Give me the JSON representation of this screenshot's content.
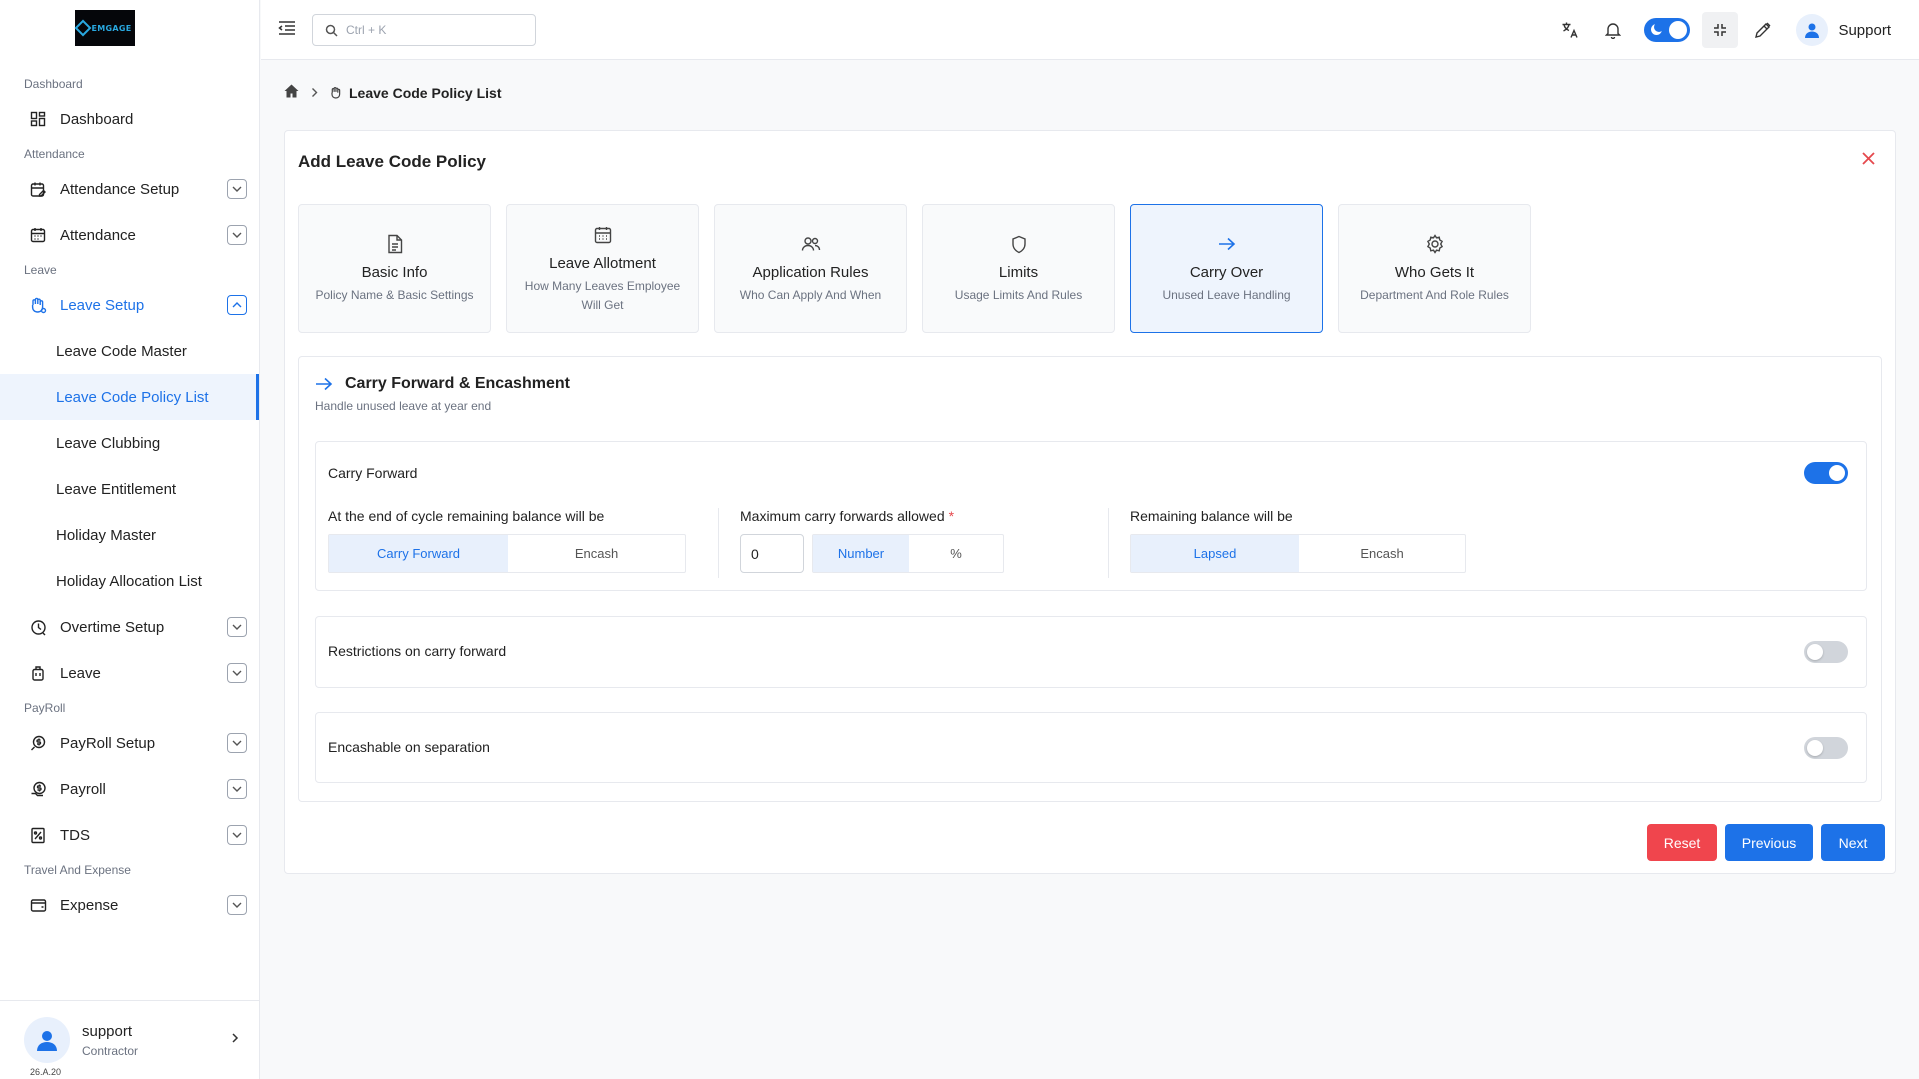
{
  "brand": {
    "logo_text": "EMGAGE"
  },
  "sidebar": {
    "sections": {
      "dashboard": "Dashboard",
      "attendance": "Attendance",
      "leave": "Leave",
      "payroll": "PayRoll",
      "travel": "Travel And Expense"
    },
    "items": {
      "dashboard": "Dashboard",
      "attendance_setup": "Attendance Setup",
      "attendance": "Attendance",
      "leave_setup": "Leave Setup",
      "overtime_setup": "Overtime Setup",
      "leave": "Leave",
      "payroll_setup": "PayRoll Setup",
      "payroll": "Payroll",
      "tds": "TDS",
      "expense": "Expense"
    },
    "leave_setup_children": [
      "Leave Code Master",
      "Leave Code Policy List",
      "Leave Clubbing",
      "Leave Entitlement",
      "Holiday Master",
      "Holiday Allocation List"
    ],
    "selected_child": "Leave Code Policy List",
    "footer": {
      "name": "support",
      "role": "Contractor",
      "version": "26.A.20"
    }
  },
  "topbar": {
    "search_placeholder": "Ctrl + K",
    "user_name": "Support",
    "icons": [
      "menu-toggle-icon",
      "search-icon",
      "translate-icon",
      "bell-icon",
      "theme-toggle",
      "fullscreen-exit-icon",
      "pen-icon",
      "user-icon"
    ]
  },
  "breadcrumb": {
    "current": "Leave Code Policy List"
  },
  "card": {
    "title": "Add Leave Code Policy",
    "steps": [
      {
        "title": "Basic Info",
        "subtitle": "Policy Name & Basic Settings",
        "icon": "document-icon"
      },
      {
        "title": "Leave Allotment",
        "subtitle": "How Many Leaves Employee Will Get",
        "icon": "calendar-icon"
      },
      {
        "title": "Application Rules",
        "subtitle": "Who Can Apply And When",
        "icon": "users-icon"
      },
      {
        "title": "Limits",
        "subtitle": "Usage Limits And Rules",
        "icon": "shield-icon"
      },
      {
        "title": "Carry Over",
        "subtitle": "Unused Leave Handling",
        "icon": "arrow-right-icon"
      },
      {
        "title": "Who Gets It",
        "subtitle": "Department And Role Rules",
        "icon": "gear-icon"
      }
    ],
    "active_step": "Carry Over",
    "panel": {
      "title": "Carry Forward & Encashment",
      "subtitle": "Handle unused leave at year end",
      "carry_forward": {
        "label": "Carry Forward",
        "enabled": true,
        "end_of_cycle_label": "At the end of cycle remaining balance will be",
        "end_of_cycle_options": [
          "Carry Forward",
          "Encash"
        ],
        "end_of_cycle_selected": "Carry Forward",
        "max_label": "Maximum carry forwards allowed",
        "max_required_mark": "*",
        "max_value": "0",
        "max_unit_options": [
          "Number",
          "%"
        ],
        "max_unit_selected": "Number",
        "remaining_label": "Remaining balance will be",
        "remaining_options": [
          "Lapsed",
          "Encash"
        ],
        "remaining_selected": "Lapsed"
      },
      "restrictions": {
        "label": "Restrictions on carry forward",
        "enabled": false
      },
      "encashable": {
        "label": "Encashable on separation",
        "enabled": false
      }
    },
    "buttons": {
      "reset": "Reset",
      "previous": "Previous",
      "next": "Next"
    }
  },
  "colors": {
    "primary": "#1d72e8",
    "danger": "#f0454d",
    "active_bg": "#eef4fd"
  }
}
